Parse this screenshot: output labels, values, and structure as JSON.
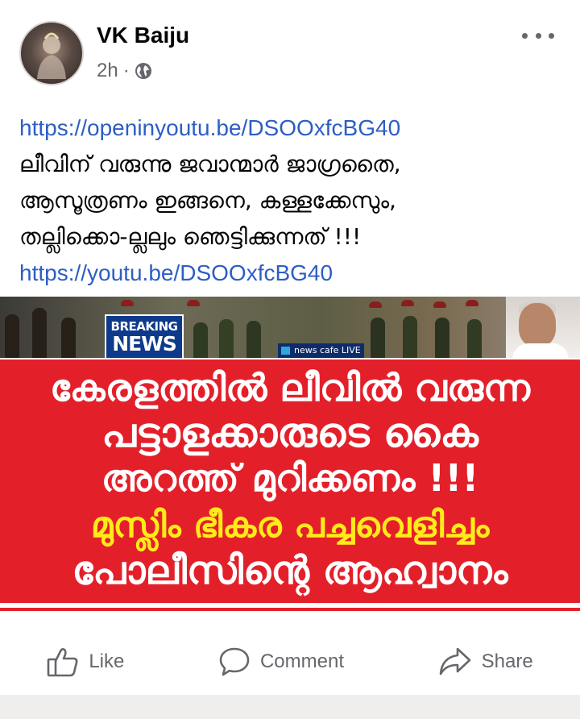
{
  "post": {
    "author": "VK Baiju",
    "time": "2h",
    "separator": "·",
    "privacy_icon": "globe-icon",
    "text": {
      "link1": "https://openinyoutu.be/DSOOxfcBG40",
      "line1": "ലീവിന് വരുന്നു ജവാന്മാർ ജാഗ്രതൈ,",
      "line2": "ആസൂത്രണം ഇങ്ങനെ, കള്ളക്കേസും,",
      "line3": "തല്ലിക്കൊ-ല്ലലും ഞെട്ടിക്കുന്നത് !!!",
      "link2": "https://youtu.be/DSOOxfcBG40"
    },
    "image": {
      "badge_top": "BREAKING",
      "badge_bottom": "NEWS",
      "channel": "news cafe LIVE",
      "headline1": "കേരളത്തിൽ ലീവിൽ വരുന്ന",
      "headline2": "പട്ടാളക്കാരുടെ കൈ",
      "headline3": "അറത്ത് മുറിക്കണം !!!",
      "headline4": "മുസ്ലിം ഭീകര പച്ചവെളിച്ചം",
      "headline5": "പോലീസിന്റെ ആഹ്വാനം"
    },
    "actions": {
      "like": "Like",
      "comment": "Comment",
      "share": "Share"
    }
  },
  "colors": {
    "link": "#2d5ec4",
    "secondary_text": "#65676b",
    "banner_red": "#e3202a",
    "headline_yellow": "#ffeb1a"
  }
}
